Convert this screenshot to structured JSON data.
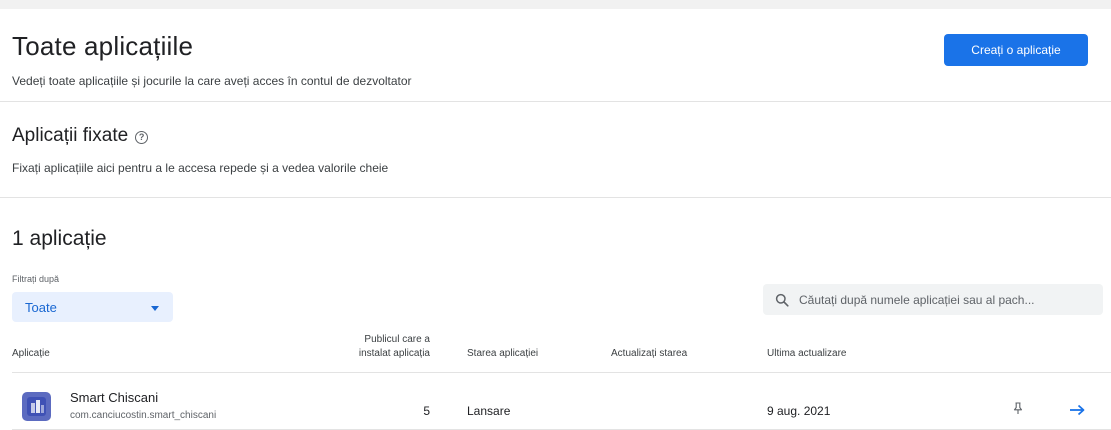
{
  "header": {
    "title": "Toate aplicațiile",
    "subtitle": "Vedeți toate aplicațiile și jocurile la care aveți acces în contul de dezvoltator",
    "create_button": "Creați o aplicație"
  },
  "pinned": {
    "title": "Aplicații fixate",
    "help_glyph": "?",
    "description": "Fixați aplicațiile aici pentru a le accesa repede și a vedea valorile cheie"
  },
  "list": {
    "title": "1 aplicație",
    "filter_label": "Filtrați după",
    "filter_value": "Toate",
    "search_placeholder": "Căutați după numele aplicației sau al pach..."
  },
  "table": {
    "headers": {
      "app": "Aplicație",
      "installed_line1": "Publicul care a",
      "installed_line2": "instalat aplicația",
      "status": "Starea aplicației",
      "update_status": "Actualizați starea",
      "last_update": "Ultima actualizare"
    },
    "rows": [
      {
        "name": "Smart Chiscani",
        "package": "com.canciucostin.smart_chiscani",
        "installed": "5",
        "status": "Lansare",
        "update_status": "",
        "last_update": "9 aug. 2021"
      }
    ]
  },
  "colors": {
    "primary": "#1a73e8",
    "filter_bg": "#e8f0fe",
    "app_icon": "#5c6bc0"
  },
  "icons": {
    "help": "help-circle-icon",
    "dropdown": "caret-down-icon",
    "search": "search-icon",
    "pin": "pin-icon",
    "open": "arrow-right-icon",
    "app": "app-icon"
  }
}
